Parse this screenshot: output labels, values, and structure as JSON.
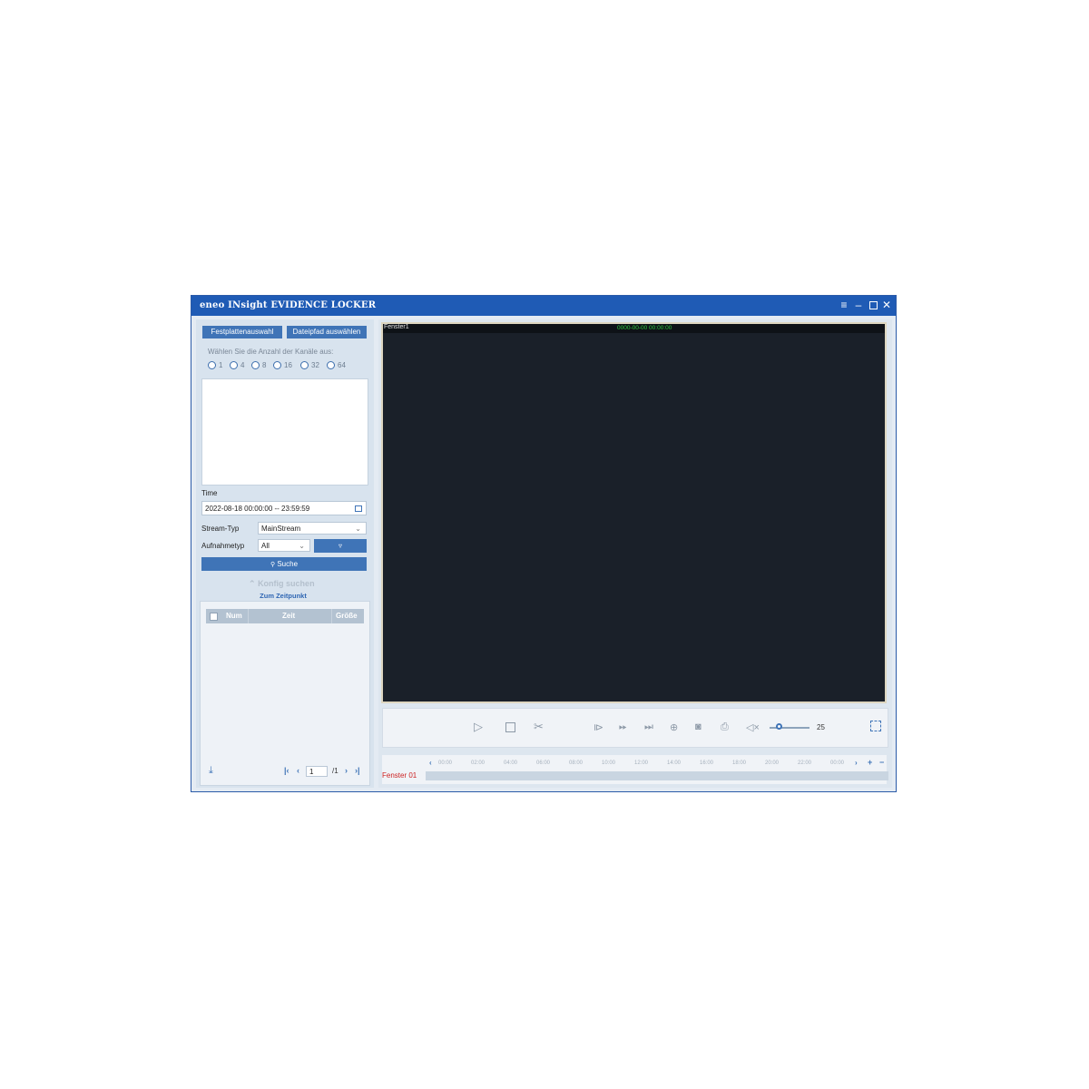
{
  "window": {
    "title": "eneo INsight EVIDENCE LOCKER",
    "controls": [
      "menu-icon",
      "minimize-icon",
      "maximize-icon",
      "close-icon"
    ]
  },
  "left": {
    "disk_button": "Festplattenauswahl",
    "path_button": "Dateipfad auswählen",
    "channel_prompt": "Wählen Sie die Anzahl der Kanäle aus:",
    "channel_options": [
      "1",
      "4",
      "8",
      "16",
      "32",
      "64"
    ],
    "time_label": "Time",
    "time_value": "2022-08-18 00:00:00 -- 23:59:59",
    "stream_label": "Stream-Typ",
    "stream_value": "MainStream",
    "rectype_label": "Aufnahmetyp",
    "rectype_value": "All",
    "search_button": "Suche",
    "config_search": "Konfig suchen",
    "jump_link": "Zum Zeitpunkt",
    "table_headers": [
      "Num",
      "Zeit",
      "Größe"
    ],
    "page_current": "1",
    "page_total": "/1"
  },
  "main": {
    "window_label": "Fenster1",
    "timestamp": "0000-00-00 00:00:00",
    "volume": "25",
    "timeline_label": "Fenster 01",
    "timeline_ticks": [
      "00:00",
      "02:00",
      "04:00",
      "06:00",
      "08:00",
      "10:00",
      "12:00",
      "14:00",
      "16:00",
      "18:00",
      "20:00",
      "22:00",
      "00:00"
    ]
  },
  "colors": {
    "titlebar": "#1f5bb5",
    "button": "#3f74b7",
    "timestamp": "#2ecc40",
    "timeline_label": "#cc2222"
  }
}
